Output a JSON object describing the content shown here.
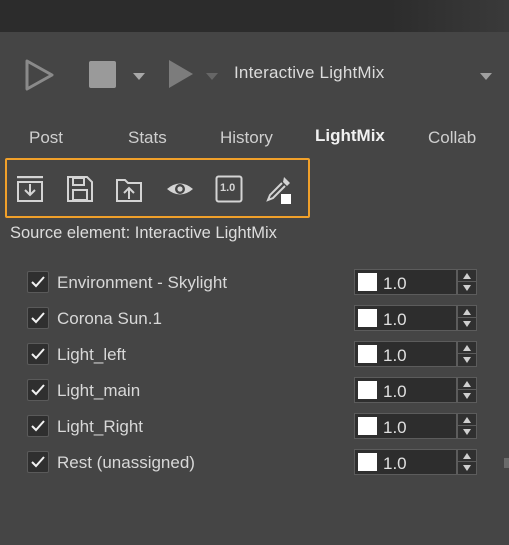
{
  "toolbar": {
    "render_title": "Interactive LightMix",
    "icons": [
      "play-outline-icon",
      "stop-icon",
      "chevron-down-icon",
      "play-icon",
      "chevron-down-icon",
      "dropdown-arrow-icon"
    ]
  },
  "tabs": [
    {
      "label": "Post"
    },
    {
      "label": "Stats"
    },
    {
      "label": "History"
    },
    {
      "label": "LightMix",
      "active": true
    },
    {
      "label": "Collab"
    }
  ],
  "tools": [
    "import-icon",
    "save-icon",
    "upload-folder-icon",
    "eye-icon",
    "value-icon",
    "eyedropper-icon"
  ],
  "tools_value_label": "1.0",
  "source_element": "Source element: Interactive LightMix",
  "lights": [
    {
      "name": "Environment - Skylight",
      "checked": true,
      "color": "#ffffff",
      "value": "1.0"
    },
    {
      "name": "Corona Sun.1",
      "checked": true,
      "color": "#ffffff",
      "value": "1.0"
    },
    {
      "name": "Light_left",
      "checked": true,
      "color": "#ffffff",
      "value": "1.0"
    },
    {
      "name": "Light_main",
      "checked": true,
      "color": "#ffffff",
      "value": "1.0"
    },
    {
      "name": "Light_Right",
      "checked": true,
      "color": "#ffffff",
      "value": "1.0"
    },
    {
      "name": "Rest (unassigned)",
      "checked": true,
      "color": "#ffffff",
      "value": "1.0"
    }
  ],
  "colors": {
    "background": "#454545",
    "highlight": "#f0a02a",
    "text": "#d7d7d7"
  }
}
